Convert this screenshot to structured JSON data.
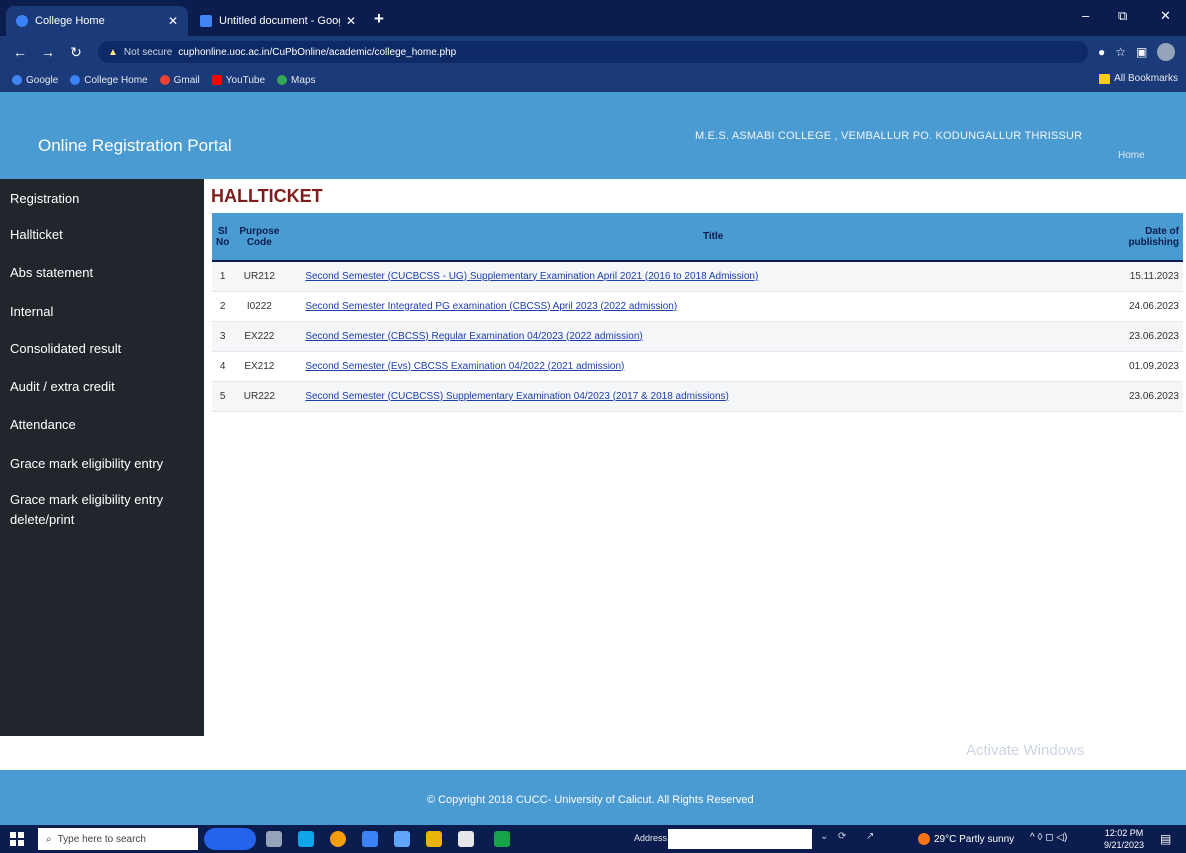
{
  "browser": {
    "tabs": [
      {
        "label": "College Home",
        "active": true
      },
      {
        "label": "Untitled document - Google Do",
        "active": false
      }
    ],
    "new_tab": "+",
    "window_controls": [
      "–",
      "⧉",
      "✕"
    ],
    "security_label": "Not secure",
    "url": "cuphonline.uoc.ac.in/CuPbOnline/academic/college_home.php",
    "bookmarks": [
      {
        "label": "Google",
        "color": "#4285f4"
      },
      {
        "label": "College Home",
        "color": "#3b82f6"
      },
      {
        "label": "Gmail",
        "color": "#ea4335"
      },
      {
        "label": "YouTube",
        "color": "#ff0000"
      },
      {
        "label": "Maps",
        "color": "#34a853"
      }
    ],
    "all_bookmarks": "All Bookmarks"
  },
  "header": {
    "portal_title": "Online Registration Portal",
    "college": "M.E.S. ASMABI COLLEGE , VEMBALLUR PO. KODUNGALLUR THRISSUR",
    "home_link": "Home"
  },
  "sidebar": {
    "items": [
      "Registration",
      "Hallticket",
      "Abs statement",
      "Internal",
      "Consolidated result",
      "Audit / extra credit",
      "Attendance",
      "Grace mark eligibility entry",
      "Grace mark eligibility entry delete/print"
    ]
  },
  "main": {
    "heading": "HALLTICKET",
    "columns": {
      "sl": "Sl No",
      "code": "Purpose Code",
      "title": "Title",
      "date": "Date of publishing"
    },
    "rows": [
      {
        "sl": "1",
        "code": "UR212",
        "title": "Second Semester (CUCBCSS - UG) Supplementary Examination April 2021 (2016 to 2018 Admission)",
        "date": "15.11.2023"
      },
      {
        "sl": "2",
        "code": "I0222",
        "title": "Second Semester Integrated PG examination (CBCSS) April 2023 (2022 admission)",
        "date": "24.06.2023"
      },
      {
        "sl": "3",
        "code": "EX222",
        "title": "Second Semester (CBCSS) Regular Examination 04/2023 (2022 admission)",
        "date": "23.06.2023"
      },
      {
        "sl": "4",
        "code": "EX212",
        "title": "Second Semester (Evs) CBCSS Examination 04/2022 (2021 admission)",
        "date": "01.09.2023"
      },
      {
        "sl": "5",
        "code": "UR222",
        "title": "Second Semester (CUCBCSS) Supplementary Examination 04/2023 (2017 & 2018 admissions)",
        "date": "23.06.2023"
      }
    ]
  },
  "watermark": "Activate Windows",
  "footer": {
    "copyright": "© Copyright 2018 CUCC- University of Calicut. All Rights Reserved"
  },
  "taskbar": {
    "search_placeholder": "Type here to search",
    "address_label": "Address",
    "weather": "29°C Partly sunny",
    "time": "12:02 PM",
    "date": "9/21/2023"
  },
  "colors": {
    "header_blue": "#4a9bd1",
    "sidebar_dark": "#20262b",
    "heading_maroon": "#7f1d1d",
    "link_blue": "#1e40af"
  }
}
